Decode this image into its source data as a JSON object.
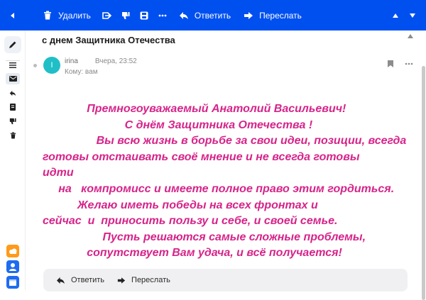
{
  "toolbar": {
    "delete_label": "Удалить",
    "reply_label": "Ответить",
    "forward_label": "Переслать",
    "bg_color": "#0050f0"
  },
  "message": {
    "subject": "с днем Защитника Отечества",
    "sender_name": "irina",
    "date": "Вчера, 23:52",
    "recipient": "Кому: вам",
    "avatar_letter": "I",
    "avatar_color": "#20bfc8",
    "body_color": "#d6248a",
    "body_lines": [
      "              Премногоуважаемый Анатолий Васильевич!",
      "                          С днём Защитника Отечества !",
      "                 Вы всю жизнь в борьбе за свои идеи, позиции, всегда",
      "готовы отстаивать своё мнение и не всегда готовы",
      "идти",
      "     на   компромисс и имеете полное право этим гордиться.",
      "           Желаю иметь победы на всех фронтах и",
      "сейчас  и  приносить пользу и себе, и своей семье.",
      "                   Пусть решаются самые сложные проблемы,",
      "              сопутствует Вам удача, и всё получается!"
    ]
  },
  "replybar": {
    "reply_label": "Ответить",
    "forward_label": "Переслать"
  },
  "icons": {
    "back": "back-arrow-icon",
    "trash": "trash-icon",
    "move": "move-icon",
    "spam": "thumb-down-icon",
    "archive": "archive-icon",
    "more": "more-dots-icon",
    "reply": "reply-arrow-icon",
    "forward": "forward-arrow-icon",
    "up": "arrow-up-icon",
    "down": "arrow-down-icon",
    "bookmark": "bookmark-icon"
  }
}
